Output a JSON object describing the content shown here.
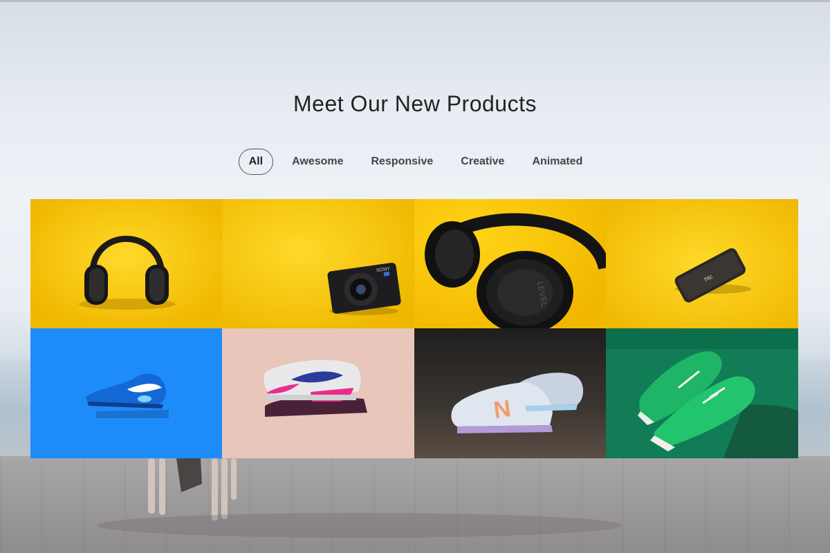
{
  "section": {
    "title": "Meet Our New Products"
  },
  "filters": [
    {
      "label": "All",
      "active": true
    },
    {
      "label": "Awesome",
      "active": false
    },
    {
      "label": "Responsive",
      "active": false
    },
    {
      "label": "Creative",
      "active": false
    },
    {
      "label": "Animated",
      "active": false
    }
  ],
  "products": [
    {
      "name": "headphones-product",
      "icon": "headphones-icon",
      "bg": "#f6c500"
    },
    {
      "name": "camera-product",
      "icon": "camera-icon",
      "bg": "#f6c500"
    },
    {
      "name": "headphones-closeup-product",
      "icon": "headphones-icon",
      "bg": "#f6c500"
    },
    {
      "name": "smartphone-product",
      "icon": "smartphone-icon",
      "bg": "#f6c500"
    },
    {
      "name": "blue-sneaker-product",
      "icon": "sneaker-icon",
      "bg": "#1e88f5"
    },
    {
      "name": "pink-sneaker-product",
      "icon": "sneaker-icon",
      "bg": "#e6c3b6"
    },
    {
      "name": "new-balance-sneakers-product",
      "icon": "sneaker-icon",
      "bg": "#2a2826"
    },
    {
      "name": "green-sneakers-product",
      "icon": "sneaker-icon",
      "bg": "#16845a"
    }
  ],
  "labels": {
    "camera_brand": "SONY",
    "phone_brand": "htc",
    "headphone_brand": "LEVEL",
    "sneaker_letter": "N"
  }
}
